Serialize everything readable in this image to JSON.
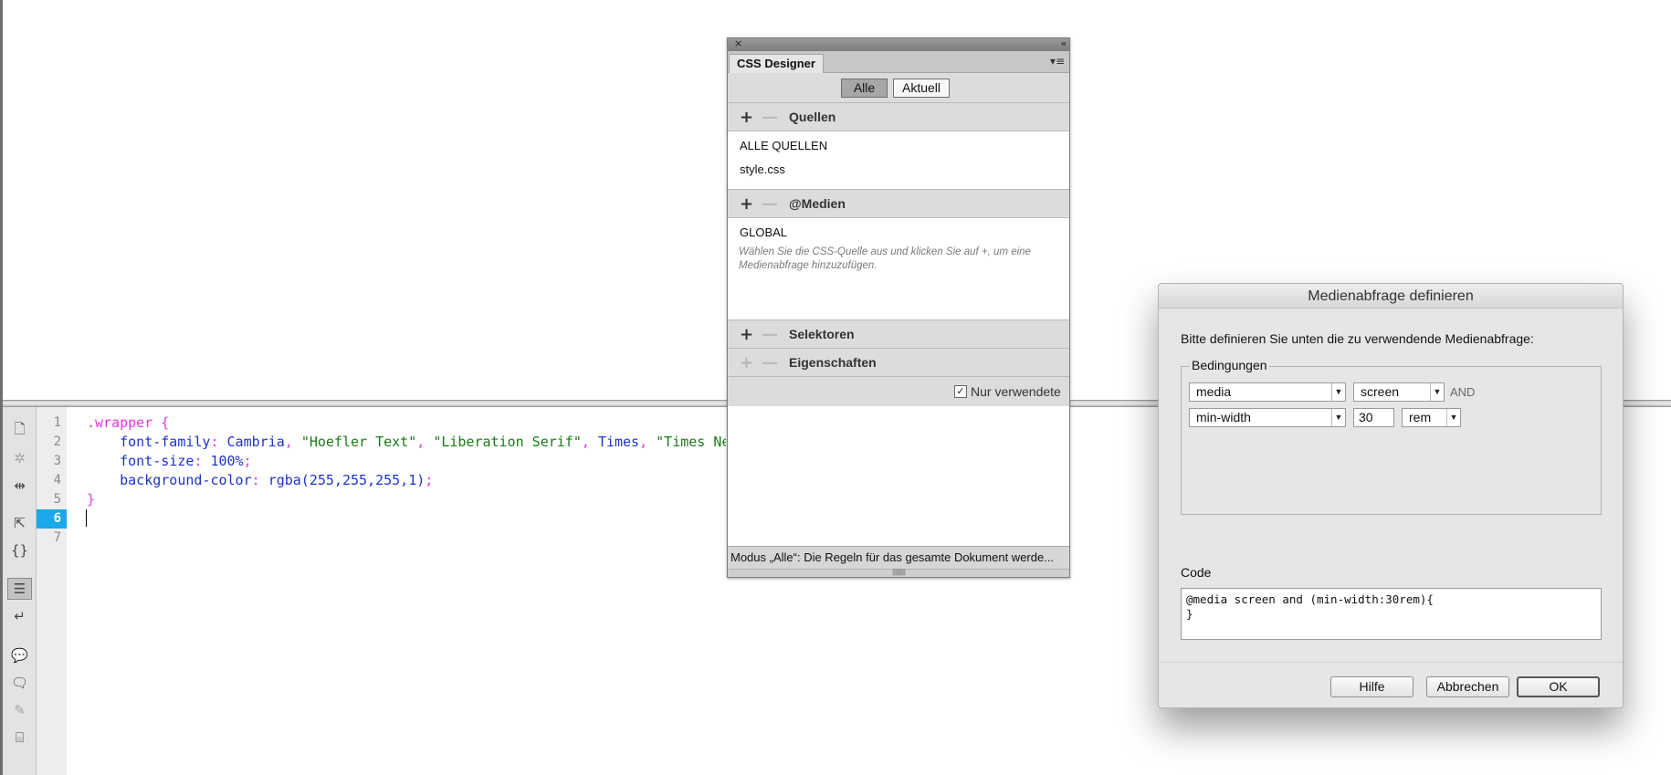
{
  "code_view": {
    "line_numbers": [
      "1",
      "2",
      "3",
      "4",
      "5",
      "6",
      "7"
    ],
    "current_line": "6",
    "lines": {
      "l1_selector": ".wrapper {",
      "l2_prop": "    font-family",
      "l2_colon": ": ",
      "l2_val1": "Cambria",
      "l2_sep1": ", ",
      "l2_str1": "\"Hoefler Text\"",
      "l2_sep2": ", ",
      "l2_str2": "\"Liberation Serif\"",
      "l2_sep3": ", ",
      "l2_val2": "Times",
      "l2_sep4": ", ",
      "l2_str3": "\"Times New Roman\"",
      "l3_prop": "    font-size",
      "l3_colon": ": ",
      "l3_val": "100%",
      "l3_semi": ";",
      "l4_prop": "    background-color",
      "l4_colon": ": ",
      "l4_val": "rgba(255,255,255,1)",
      "l4_semi": ";",
      "l5_close": "}"
    },
    "toolbar_icons": [
      "open-documents-icon",
      "show-code-navigator-icon",
      "collapse-full-tag-icon",
      "select-parent-tag-icon",
      "balance-braces-icon",
      "line-numbers-icon",
      "word-wrap-icon",
      "apply-comment-icon",
      "remove-comment-icon",
      "format-source-code-icon",
      "wrap-tag-icon"
    ]
  },
  "css_designer": {
    "tab_label": "CSS Designer",
    "close_glyph": "×",
    "collapse_glyph": "‹‹",
    "menu_glyph": "▾≡",
    "mode_buttons": {
      "all": "Alle",
      "current": "Aktuell"
    },
    "sections": {
      "sources": {
        "title": "Quellen",
        "plus": "+",
        "minus": "—"
      },
      "media": {
        "title": "@Medien",
        "plus": "+",
        "minus": "—"
      },
      "selectors": {
        "title": "Selektoren",
        "plus": "+",
        "minus": "—"
      },
      "properties": {
        "title": "Eigenschaften",
        "plus": "+",
        "minus": "—"
      }
    },
    "sources_list": [
      "ALLE QUELLEN",
      "style.css"
    ],
    "media_list": [
      "GLOBAL"
    ],
    "media_hint": "Wählen Sie die CSS-Quelle aus und klicken Sie auf +, um eine Medienabfrage hinzuzufügen.",
    "show_set_label": "Nur verwendete",
    "show_set_checked": true,
    "status_text": "Modus „Alle“: Die Regeln für das gesamte Dokument werde..."
  },
  "dialog": {
    "title": "Medienabfrage definieren",
    "prompt": "Bitte definieren Sie unten die zu verwendende Medienabfrage:",
    "conditions_label": "Bedingungen",
    "row1": {
      "type": "media",
      "value": "screen",
      "conjunction": "AND"
    },
    "row2": {
      "feature": "min-width",
      "value": "30",
      "unit": "rem"
    },
    "code_label": "Code",
    "code_line1": "@media screen and (min-width:30rem){",
    "code_line2": "}",
    "buttons": {
      "help": "Hilfe",
      "cancel": "Abbrechen",
      "ok": "OK"
    }
  },
  "colors": {
    "current_line_highlight": "#1aa9ea",
    "selector": "#e03ae0",
    "property": "#1d33c8",
    "string": "#1b7a17"
  }
}
